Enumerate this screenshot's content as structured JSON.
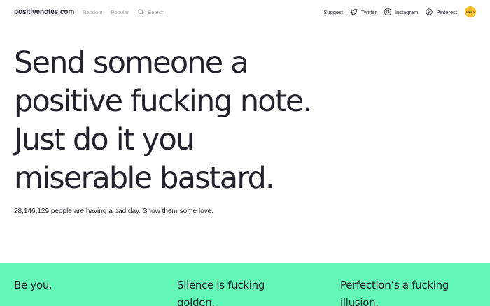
{
  "nav": {
    "logo": "positivenotes.com",
    "links": [
      "Random",
      "Popular"
    ],
    "search_label": "Search",
    "right_links": [
      "Suggest",
      "Twitter",
      "Instagram",
      "Pinterest"
    ],
    "why_label": "WHY?"
  },
  "hero": {
    "heading_lines": [
      "Send someone a",
      "positive fucking note.",
      "Just do it you",
      "miserable bastard."
    ],
    "subtext": "28,146,129 people are having a bad day. Show them some love."
  },
  "notes": [
    "Be you.",
    "Silence is fucking golden.",
    "Perfection’s a fucking illusion."
  ],
  "colors": {
    "notes_bg": "#64f8b8",
    "why_bg": "#f9c22c",
    "text": "#23232b",
    "muted": "#a8a8ad"
  },
  "icons": {
    "search": "search-icon",
    "twitter": "twitter-icon",
    "instagram": "instagram-icon",
    "pinterest": "pinterest-icon"
  }
}
